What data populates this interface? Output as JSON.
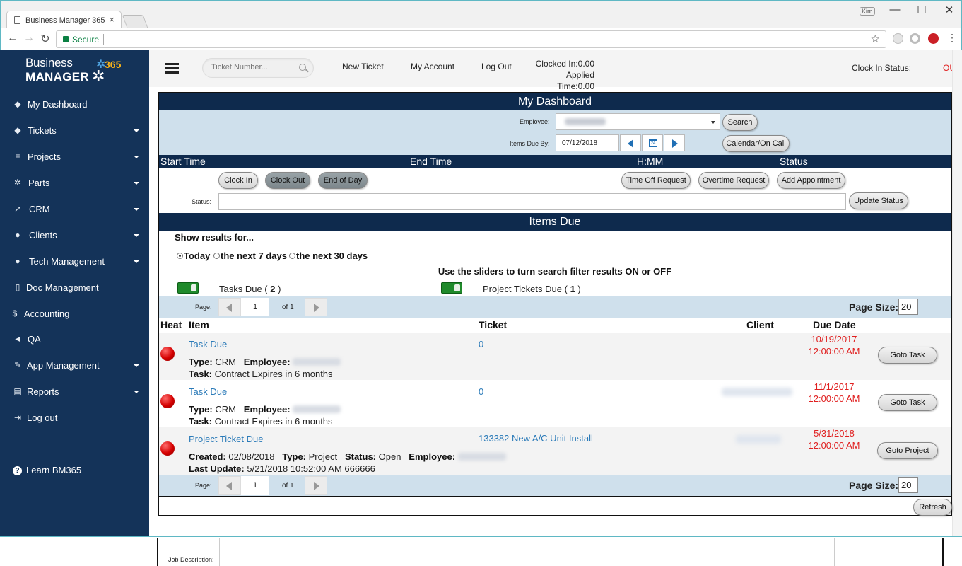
{
  "browser": {
    "tab_title": "Business Manager 365",
    "tab_close": "×",
    "secure_label": "Secure",
    "back_glyph": "←",
    "forward_glyph": "→",
    "reload_glyph": "↻",
    "star_glyph": "☆",
    "user_chip": "Kim",
    "minimize_glyph": "—",
    "maximize_glyph": "☐",
    "close_glyph": "✕"
  },
  "brand": {
    "line1": "Business",
    "line2": "MANAGER",
    "badge": "365",
    "accent": "#f5b21a"
  },
  "sidebar": {
    "items": [
      {
        "label": "My Dashboard",
        "icon": "tag-icon",
        "glyph": "◆"
      },
      {
        "label": "Tickets",
        "icon": "tag-icon",
        "glyph": "◆"
      },
      {
        "label": "Projects",
        "icon": "list-icon",
        "glyph": "≡"
      },
      {
        "label": "Parts",
        "icon": "cogs-icon",
        "glyph": "✲"
      },
      {
        "label": "CRM",
        "icon": "chart-line-icon",
        "glyph": "↗"
      },
      {
        "label": "Clients",
        "icon": "users-icon",
        "glyph": "●"
      },
      {
        "label": "Tech Management",
        "icon": "users-icon",
        "glyph": "●"
      },
      {
        "label": "Doc Management",
        "icon": "file-icon",
        "glyph": "▯"
      },
      {
        "label": "Accounting",
        "icon": "dollar-icon",
        "glyph": "$"
      },
      {
        "label": "QA",
        "icon": "bullhorn-icon",
        "glyph": "◄"
      },
      {
        "label": "App Management",
        "icon": "wrench-icon",
        "glyph": "✎"
      },
      {
        "label": "Reports",
        "icon": "file-text-icon",
        "glyph": "▤"
      },
      {
        "label": "Log out",
        "icon": "sign-out-icon",
        "glyph": "⇥"
      },
      {
        "label": "Learn BM365",
        "icon": "question-circle-icon",
        "glyph": "?"
      }
    ]
  },
  "header": {
    "ticket_placeholder": "Ticket Number...",
    "new_ticket": "New Ticket",
    "my_account": "My Account",
    "log_out": "Log Out",
    "clocked_in": "Clocked In:0.00",
    "applied_time": "Applied Time:0.00",
    "clock_in_status_label": "Clock In Status:",
    "clock_in_status_value": "OUT",
    "status_color": "#e02020"
  },
  "dashboard": {
    "title": "My Dashboard",
    "employee_label": "Employee:",
    "items_due_by_label": "Items Due By:",
    "date_value": "07/12/2018",
    "search_button": "Search",
    "calendar_button": "Calendar/On Call",
    "calendar_icon_text": "24",
    "time_columns": [
      "Start Time",
      "End Time",
      "H:MM",
      "Status"
    ],
    "buttons": {
      "clock_in": "Clock In",
      "clock_out": "Clock Out",
      "end_of_day": "End of Day",
      "time_off": "Time Off Request",
      "overtime": "Overtime Request",
      "add_appointment": "Add Appointment",
      "update_status": "Update Status"
    },
    "status_label": "Status:"
  },
  "items_due": {
    "title": "Items Due",
    "show_results": "Show results for...",
    "ranges": [
      {
        "label": "Today",
        "selected": true
      },
      {
        "label": "the next 7 days",
        "selected": false
      },
      {
        "label": "the next 30 days",
        "selected": false
      }
    ],
    "slider_hint": "Use the sliders to turn search filter results ON or OFF",
    "filters": {
      "tasks_label": "Tasks Due (",
      "tasks_count": "2",
      "projects_label": "Project Tickets Due (",
      "projects_count": "1",
      "close_paren": ")",
      "tasks_on": true,
      "projects_on": true
    },
    "pager": {
      "page_label": "Page:",
      "page_value": "1",
      "of_label": "of 1",
      "page_size_label": "Page Size:",
      "page_size": "20"
    },
    "columns": {
      "heat": "Heat",
      "item": "Item",
      "ticket": "Ticket",
      "client": "Client",
      "due_date": "Due Date"
    },
    "rows": [
      {
        "item": "Task Due",
        "ticket": "0",
        "type_label": "Type:",
        "type": "CRM",
        "employee_label": "Employee:",
        "task_label": "Task:",
        "task": "Contract Expires in 6 months",
        "due_date": "10/19/2017",
        "due_time": "12:00:00 AM",
        "action": "Goto Task"
      },
      {
        "item": "Task Due",
        "ticket": "0",
        "type_label": "Type:",
        "type": "CRM",
        "employee_label": "Employee:",
        "task_label": "Task:",
        "task": "Contract Expires in 6 months",
        "due_date": "11/1/2017",
        "due_time": "12:00:00 AM",
        "action": "Goto Task"
      },
      {
        "item": "Project Ticket Due",
        "ticket": "133382 New A/C Unit Install",
        "created_label": "Created:",
        "created": "02/08/2018",
        "type_label": "Type:",
        "type": "Project",
        "status_label": "Status:",
        "status": "Open",
        "employee_label": "Employee:",
        "last_update_label": "Last Update:",
        "last_update": "5/21/2018 10:52:00 AM 666666",
        "due_date": "5/31/2018",
        "due_time": "12:00:00 AM",
        "action": "Goto Project"
      }
    ],
    "refresh_button": "Refresh"
  },
  "below": {
    "job_description_label": "Job Description:"
  }
}
